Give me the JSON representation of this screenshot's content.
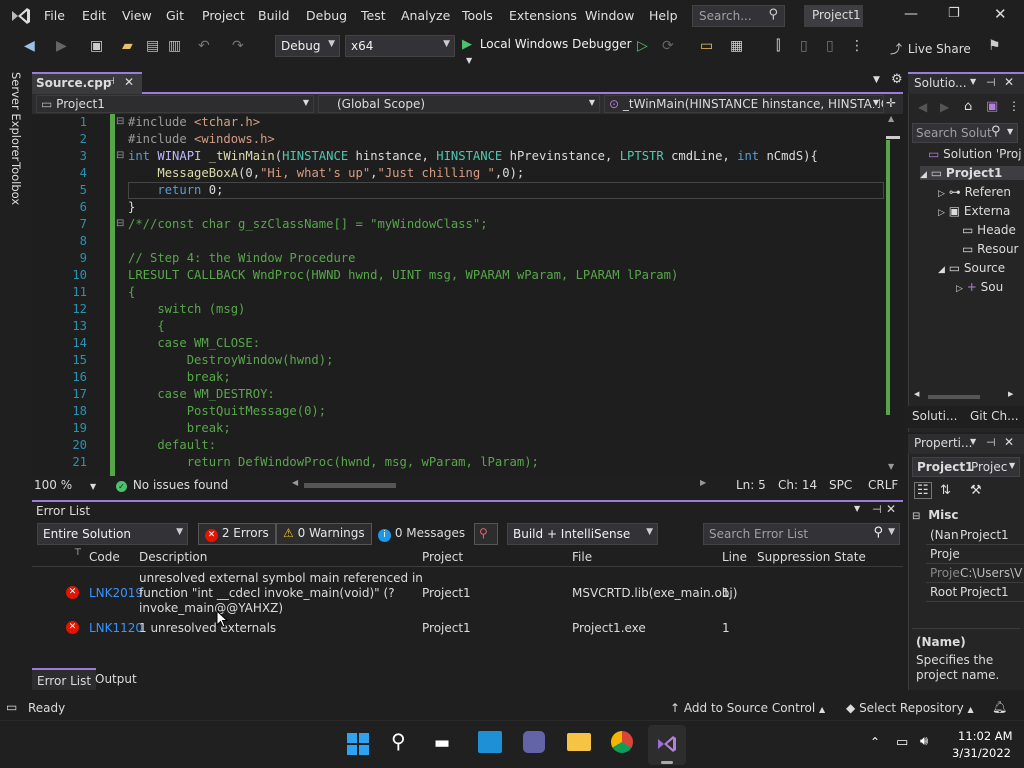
{
  "titlebar": {
    "menus": [
      "File",
      "Edit",
      "View",
      "Git",
      "Project",
      "Build",
      "Debug",
      "Test",
      "Analyze",
      "Tools",
      "Extensions",
      "Window",
      "Help"
    ],
    "search_placeholder": "Search...",
    "solution_name": "Project1"
  },
  "toolbar": {
    "config": "Debug",
    "platform": "x64",
    "run_label": "Local Windows Debugger",
    "live_share": "Live Share"
  },
  "left_strip": {
    "server_explorer": "Server Explorer",
    "toolbox": "Toolbox"
  },
  "editor": {
    "tab_name": "Source.cpp",
    "project_dropdown": "Project1",
    "scope_dropdown": "(Global Scope)",
    "member_dropdown": "_tWinMain(HINSTANCE hinstance, HINSTANCE",
    "zoom": "100 %",
    "issues": "No issues found",
    "position": {
      "ln": "Ln: 5",
      "ch": "Ch: 14",
      "spc": "SPC",
      "crlf": "CRLF"
    },
    "line_numbers": [
      "1",
      "2",
      "3",
      "4",
      "5",
      "6",
      "7",
      "8",
      "9",
      "10",
      "11",
      "12",
      "13",
      "14",
      "15",
      "16",
      "17",
      "18",
      "19",
      "20",
      "21"
    ]
  },
  "error_list": {
    "title": "Error List",
    "scope": "Entire Solution",
    "errors": "2 Errors",
    "warnings": "0 Warnings",
    "messages": "0 Messages",
    "source": "Build + IntelliSense",
    "search_placeholder": "Search Error List",
    "columns": [
      "Code",
      "Description",
      "Project",
      "File",
      "Line",
      "Suppression State"
    ],
    "rows": [
      {
        "code": "LNK2019",
        "description_lines": [
          "unresolved external symbol main referenced in",
          "function \"int __cdecl invoke_main(void)\" (?",
          "invoke_main@@YAHXZ)"
        ],
        "project": "Project1",
        "file": "MSVCRTD.lib(exe_main.obj)",
        "line": "1"
      },
      {
        "code": "LNK1120",
        "description_lines": [
          "1 unresolved externals"
        ],
        "project": "Project1",
        "file": "Project1.exe",
        "line": "1"
      }
    ],
    "bottom_tabs": [
      "Error List",
      "Output"
    ]
  },
  "solution_explorer": {
    "tab": "Solutio...",
    "search_placeholder": "Search Solut",
    "items": [
      "Solution 'Proj",
      "Project1",
      "Referen",
      "Externa",
      "Heade",
      "Resour",
      "Source",
      "Sou"
    ],
    "bottom_tabs": [
      "Soluti...",
      "Git Ch..."
    ]
  },
  "properties": {
    "tab": "Properti...",
    "object": "Project1",
    "object_type": "Projec",
    "category": "Misc",
    "rows": [
      {
        "name": "(Nan",
        "value": "Project1"
      },
      {
        "name": "Proje",
        "value": ""
      },
      {
        "name": "Proje",
        "value": "C:\\Users\\V"
      },
      {
        "name": "Root",
        "value": "Project1"
      }
    ],
    "desc_title": "(Name)",
    "desc_text_lines": [
      "Specifies the",
      "project name."
    ]
  },
  "statusbar": {
    "ready": "Ready",
    "source_control": "Add to Source Control",
    "repository": "Select Repository"
  },
  "taskbar": {
    "time": "11:02 AM",
    "date": "3/31/2022"
  }
}
